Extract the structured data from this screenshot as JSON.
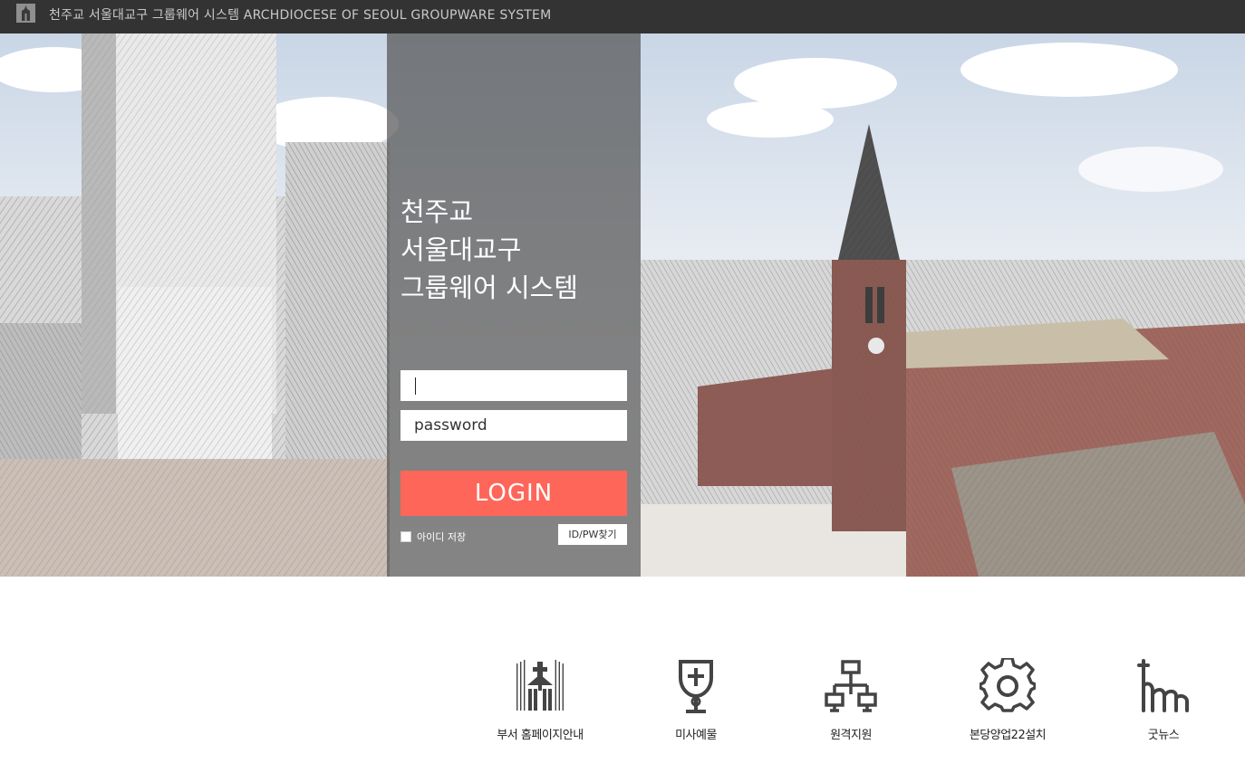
{
  "header": {
    "title": "천주교 서울대교구 그룹웨어 시스템 ARCHDIOCESE OF SEOUL GROUPWARE SYSTEM",
    "logo_icon": "cathedral-logo-icon"
  },
  "login": {
    "headline": [
      "천주교",
      "서울대교구",
      "그룹웨어 시스템"
    ],
    "id_value": "",
    "id_placeholder": "",
    "password_value": "password",
    "login_label": "LOGIN",
    "save_id_label": "아이디 저장",
    "save_id_checked": false,
    "find_label": "ID/PW찾기"
  },
  "services": [
    {
      "label": "부서 홈페이지안내",
      "icon": "church-building-icon"
    },
    {
      "label": "미사예물",
      "icon": "chalice-icon"
    },
    {
      "label": "원격지원",
      "icon": "network-icon"
    },
    {
      "label": "본당양업22설치",
      "icon": "gear-icon"
    },
    {
      "label": "굿뉴스",
      "icon": "cross-hand-icon"
    }
  ],
  "colors": {
    "topbar": "#333333",
    "login_button": "#ff665a",
    "panel_overlay": "#505050"
  }
}
